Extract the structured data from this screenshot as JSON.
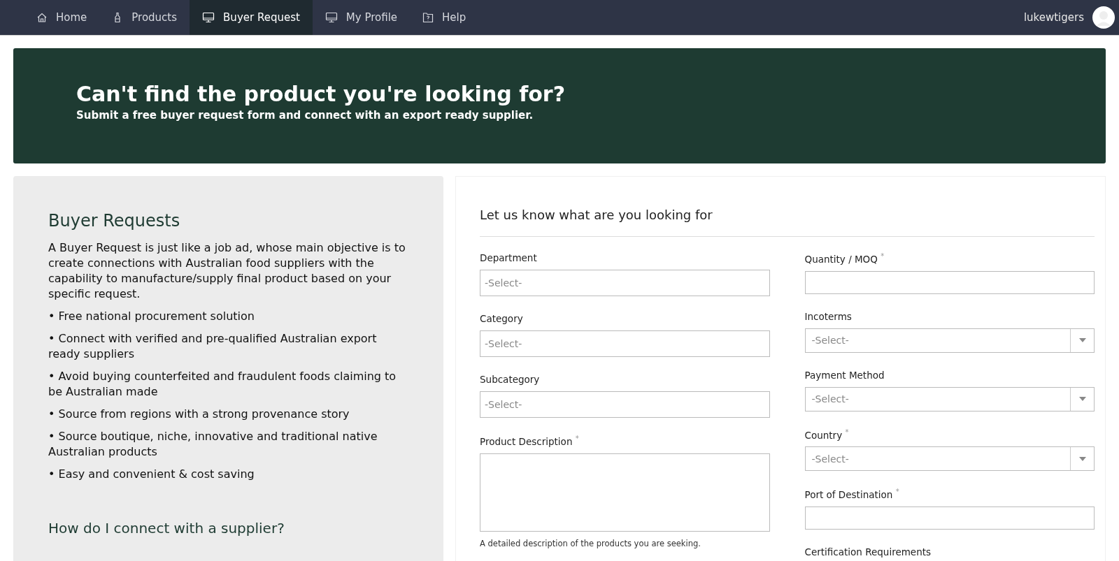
{
  "nav": {
    "items": [
      {
        "label": "Home",
        "kind": "home",
        "selected": false
      },
      {
        "label": "Products",
        "kind": "bottle",
        "selected": false
      },
      {
        "label": "Buyer Request",
        "kind": "monitor",
        "selected": true
      },
      {
        "label": "My Profile",
        "kind": "monitor",
        "selected": false
      },
      {
        "label": "Help",
        "kind": "help",
        "selected": false
      }
    ],
    "username": "lukewtigers"
  },
  "banner": {
    "title": "Can't find the product you're looking for?",
    "subtitle": "Submit a free buyer request form and connect with an export ready supplier."
  },
  "info": {
    "title": "Buyer Requests",
    "intro": "A Buyer Request is just like a job ad, whose main objective is to create connections with Australian food suppliers with the capability to manufacture/supply final product based on your specific request.",
    "bullets": [
      "• Free national procurement solution",
      "• Connect with verified and pre-qualified Australian export ready suppliers",
      "• Avoid buying counterfeited and fraudulent foods claiming to be Australian made",
      "• Source from regions with a strong provenance story",
      "• Source boutique, niche, innovative and traditional native Australian products",
      "• Easy and convenient & cost saving"
    ],
    "subtitle": "How do I connect with a supplier?"
  },
  "form": {
    "title": "Let us know what are you looking for",
    "columns": [
      [
        {
          "label": "Department",
          "kind": "select",
          "placeholder": "-Select-"
        },
        {
          "label": "Category",
          "kind": "select",
          "placeholder": "-Select-"
        },
        {
          "label": "Subcategory",
          "kind": "select",
          "placeholder": "-Select-"
        },
        {
          "label": "Product Description $^{*}$",
          "kind": "textarea",
          "help": "A detailed description of the products you are seeking."
        }
      ],
      [
        {
          "label": "Quantity / MOQ $^{*}$",
          "kind": "text"
        },
        {
          "label": "Incoterms",
          "kind": "dropdown",
          "placeholder": "-Select-"
        },
        {
          "label": "Payment Method",
          "kind": "dropdown",
          "placeholder": "-Select-"
        },
        {
          "label": "Country $^{*}$",
          "kind": "dropdown",
          "placeholder": "-Select-"
        },
        {
          "label": "Port of Destination $^{*}$",
          "kind": "text"
        },
        {
          "label": "Certification Requirements",
          "kind": "none"
        }
      ]
    ]
  }
}
